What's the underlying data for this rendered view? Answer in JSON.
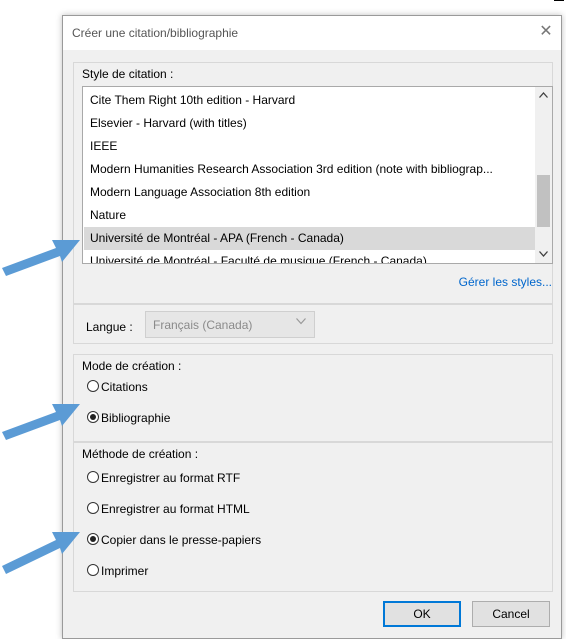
{
  "dialog": {
    "title": "Créer une citation/bibliographie",
    "close_glyph": "✕"
  },
  "citation_style": {
    "label": "Style de citation :",
    "items": [
      "Cite Them Right 10th edition - Harvard",
      "Elsevier - Harvard (with titles)",
      "IEEE",
      "Modern Humanities Research Association 3rd edition (note with bibliograp...",
      "Modern Language Association 8th edition",
      "Nature",
      "Université de Montréal - APA (French - Canada)",
      "Université de Montréal - Faculté de musique (French - Canada)"
    ],
    "selected_index": 6,
    "manage_link": "Gérer les styles..."
  },
  "language": {
    "label": "Langue :",
    "value": "Français (Canada)"
  },
  "creation_mode": {
    "label": "Mode de création :",
    "options": [
      "Citations",
      "Bibliographie"
    ],
    "selected": "Bibliographie"
  },
  "creation_method": {
    "label": "Méthode de création :",
    "options": [
      "Enregistrer au format RTF",
      "Enregistrer au format HTML",
      "Copier dans le presse-papiers",
      "Imprimer"
    ],
    "selected": "Copier dans le presse-papiers"
  },
  "buttons": {
    "ok": "OK",
    "cancel": "Cancel"
  },
  "colors": {
    "arrow": "#5b9bd5",
    "link": "#0066cc",
    "selection": "#d9d9d9",
    "ok_border": "#0078d7"
  },
  "icons": {
    "close": "close-icon",
    "scroll_up": "chevron-up-icon",
    "scroll_down": "chevron-down-icon",
    "dropdown": "chevron-down-icon",
    "pointer": "arrow-icon"
  }
}
